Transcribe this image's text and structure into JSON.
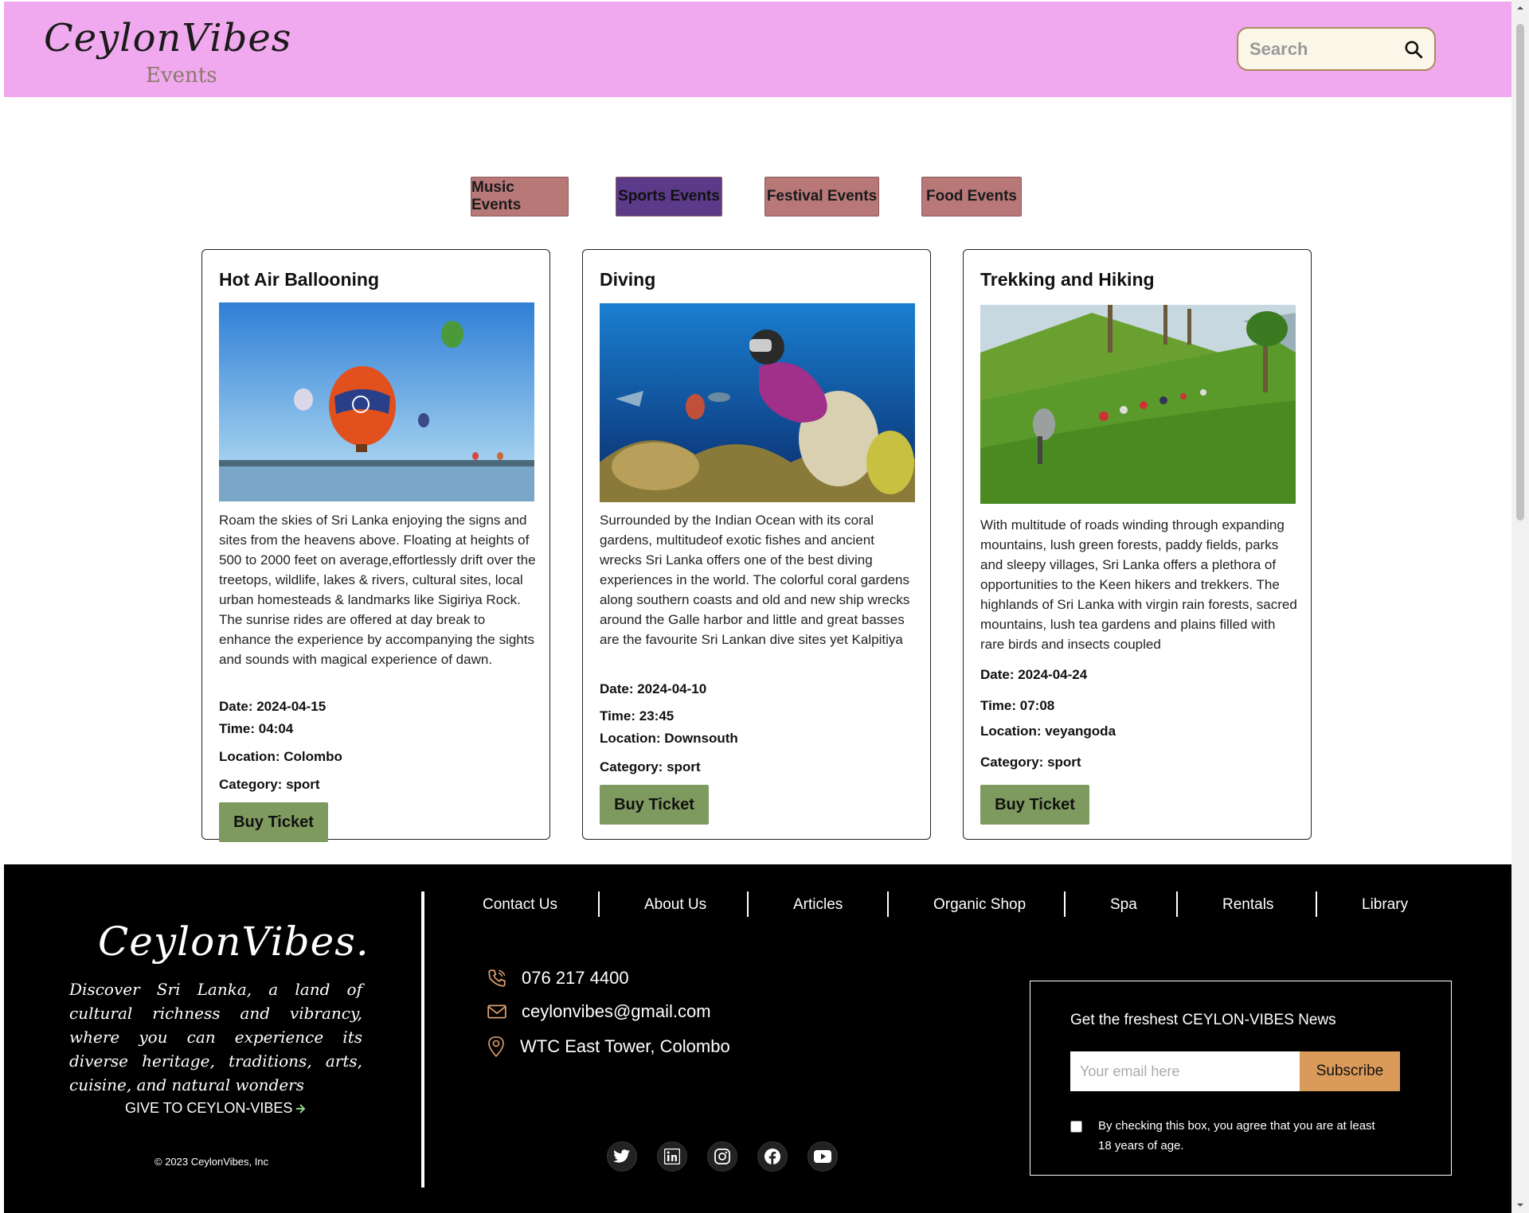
{
  "header": {
    "logo_main": "CeylonVibes",
    "logo_sub": "Events",
    "search_placeholder": "Search"
  },
  "tabs": [
    {
      "label": "Music Events",
      "active": false
    },
    {
      "label": "Sports Events",
      "active": true
    },
    {
      "label": "Festival Events",
      "active": false
    },
    {
      "label": "Food Events",
      "active": false
    }
  ],
  "events": [
    {
      "title": "Hot Air Ballooning",
      "description": "Roam the skies of Sri Lanka enjoying the signs and sites from the heavens above. Floating at heights of 500 to 2000 feet on average,effortlessly drift over the treetops, wildlife, lakes & rivers, cultural sites, local urban homesteads & landmarks like Sigiriya Rock. The sunrise rides are offered at day break to enhance the experience by accompanying the sights and sounds with magical experience of dawn.",
      "date": "Date: 2024-04-15",
      "time": "Time: 04:04",
      "location": "Location: Colombo",
      "category": "Category: sport",
      "button": "Buy Ticket"
    },
    {
      "title": "Diving",
      "description": "Surrounded by the Indian Ocean with its coral gardens, multitudeof exotic fishes and ancient wrecks Sri Lanka offers one of the best diving experiences in the world. The colorful coral gardens along southern coasts and old and new ship wrecks around the Galle harbor and little and great basses are the favourite Sri Lankan dive sites yet Kalpitiya",
      "date": "Date: 2024-04-10",
      "time": "Time: 23:45",
      "location": "Location: Downsouth",
      "category": "Category: sport",
      "button": "Buy Ticket"
    },
    {
      "title": "Trekking and Hiking",
      "description": "With multitude of roads winding through expanding mountains, lush green forests, paddy fields, parks and sleepy villages, Sri Lanka offers a plethora of opportunities to the Keen hikers and trekkers. The highlands of Sri Lanka with virgin rain forests, sacred mountains, lush tea gardens and plains filled with rare birds and insects coupled",
      "date": "Date: 2024-04-24",
      "time": "Time: 07:08",
      "location": "Location: veyangoda",
      "category": "Category: sport",
      "button": "Buy Ticket"
    }
  ],
  "footer": {
    "logo": "CeylonVibes.",
    "tagline": "Discover Sri Lanka, a land of cultural richness and vibrancy, where you can experience its diverse heritage, traditions, arts, cuisine, and natural wonders",
    "give": "GIVE TO CEYLON-VIBES",
    "copyright": "© 2023 CeylonVibes, Inc",
    "nav": [
      "Contact Us",
      "About Us",
      "Articles",
      "Organic Shop",
      "Spa",
      "Rentals",
      "Library"
    ],
    "phone": "076 217 4400",
    "email": "ceylonvibes@gmail.com",
    "address": "WTC East Tower, Colombo",
    "social": [
      "twitter-icon",
      "linkedin-icon",
      "instagram-icon",
      "facebook-icon",
      "youtube-icon"
    ],
    "newsletter": {
      "title": "Get the freshest CEYLON-VIBES News",
      "placeholder": "Your email here",
      "button": "Subscribe",
      "consent": "By checking this box, you agree that you are at least 18 years of age."
    }
  },
  "colors": {
    "header_bg": "#f0a8ee",
    "tab_bg": "#b87878",
    "tab_active_bg": "#5c3a8a",
    "buy_button": "#7f9a5f",
    "subscribe_button": "#d99a5a",
    "footer_bg": "#000000"
  }
}
